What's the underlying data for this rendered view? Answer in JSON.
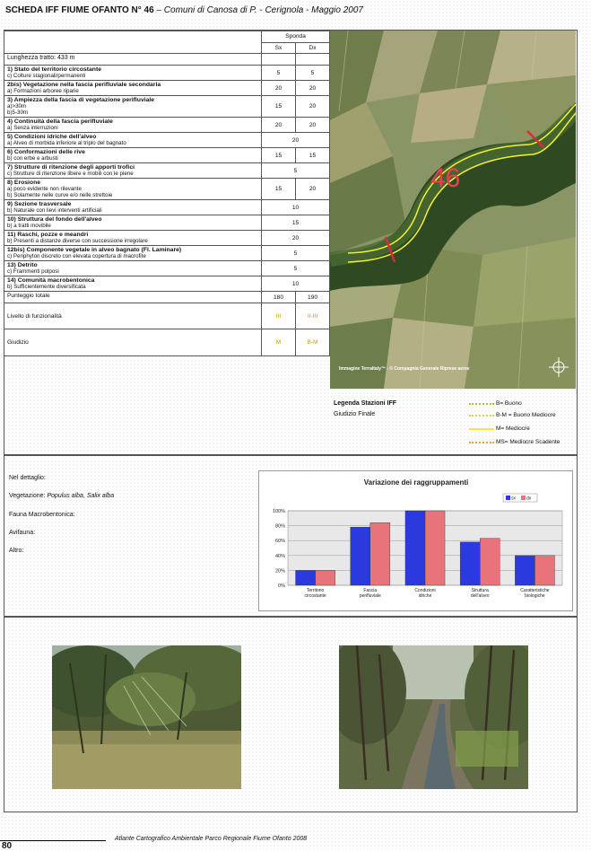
{
  "header": {
    "title_bold": "SCHEDA IFF FIUME OFANTO N° 46",
    "title_rest": " – Comuni di Canosa di P. - Cerignola - Maggio 2007"
  },
  "table": {
    "sponda_label": "Sponda",
    "sx_label": "Sx",
    "dx_label": "Dx",
    "lunghezza": "Lunghezza tratto: 433 m",
    "criteria": [
      {
        "title": "1) Stato del territorio circostante",
        "sub": "c) Colture stagionali/permanenti",
        "sx": "5",
        "dx": "5"
      },
      {
        "title": "2bis) Vegetazione nella fascia perifluviale secondaria",
        "sub": "a) Formazioni arboree riparie",
        "sx": "20",
        "dx": "20"
      },
      {
        "title": "3) Ampiezza della fascia di vegetazione perifluviale",
        "sub": "a)>30m",
        "sub2": "b)5-30m",
        "sx": "15",
        "dx": "20"
      },
      {
        "title": "4) Continuità della fascia perifluviale",
        "sub": "a) Senza interruzioni",
        "sx": "20",
        "dx": "20"
      },
      {
        "title": "5) Condizioni idriche dell'alveo",
        "sub": "a) Alveo di morbida inferiore al triplo del bagnato",
        "both": "20"
      },
      {
        "title": "6) Conformazioni delle rive",
        "sub": "b) con erbe e arbusti",
        "sx": "15",
        "dx": "15"
      },
      {
        "title": "7) Strutture di ritenzione degli apporti trofici",
        "sub": "c) Strutture di ritenzione libere e mobili con le piene",
        "both": "5"
      },
      {
        "title": "8) Erosione",
        "sub": "a) poco evidente  non rilevante",
        "sub2": "b) Solamente nelle curve e/o nelle strettoie",
        "sx": "15",
        "dx": "20"
      },
      {
        "title": "9) Sezione trasversale",
        "sub": "b) Naturale con lievi interventi artificiali",
        "both": "10"
      },
      {
        "title": "10) Struttura del fondo dell'alveo",
        "sub": "b) a tratti movibile",
        "both": "15"
      },
      {
        "title": "11) Raschi, pozze e meandri",
        "sub": "b) Presenti a distanze diverse con successione irregolare",
        "both": "20"
      },
      {
        "title": "12bis) Componente vegetale in alveo bagnato (Fl. Laminare)",
        "sub": "c) Periphyton discreto con elevata copertura di macrofite",
        "both": "5"
      },
      {
        "title": "13) Detrito",
        "sub": "c) Frammenti polposi",
        "both": "5"
      },
      {
        "title": "14) Comunità macrobentonica",
        "sub": "b) Sufficientemente diversificata",
        "both": "10"
      }
    ],
    "punteggio_label": "Punteggio totale",
    "punteggio_sx": "180",
    "punteggio_dx": "190",
    "livello_label": "Livello di funzionalità",
    "livello_sx": "III",
    "livello_dx": "II-III",
    "giudizio_label": "Giudizio",
    "giudizio_sx": "M",
    "giudizio_dx": "B-M"
  },
  "map": {
    "station_number": "46",
    "credit": "Immagine TerraItaly™ - © Compagnia Generale Riprese aeree"
  },
  "legend": {
    "title": "Legenda Stazioni IFF",
    "subtitle": "Giudizio Finale",
    "items": [
      {
        "label": "B= Buono",
        "color": "#9ccc33"
      },
      {
        "label": "B-M = Buono Mediocre",
        "color": "#c8dd44"
      },
      {
        "label": "M= Mediocre",
        "color": "#f2ea2a"
      },
      {
        "label": "MS= Mediocre Scadente",
        "color": "#e8a820"
      }
    ]
  },
  "details": {
    "dettaglio": "Nel dettaglio:",
    "vegetazione_label": "Vegetazione: ",
    "vegetazione_species1": "Populus alba",
    "vegetazione_sep": ", ",
    "vegetazione_species2": "Salix alba",
    "fauna": "Fauna Macrobentonica:",
    "avifauna": "Avifauna:",
    "altro": "Altro:"
  },
  "chart_data": {
    "type": "bar",
    "title": "Variazione dei raggruppamenti",
    "categories": [
      "Territorio circostante",
      "Fascia perifluviale",
      "Condizioni idriche",
      "Struttura dell'alveo",
      "Caratteristiche biologiche"
    ],
    "series": [
      {
        "name": "sx",
        "values": [
          20,
          78,
          100,
          58,
          40
        ],
        "color": "#2a3adf"
      },
      {
        "name": "dx",
        "values": [
          20,
          84,
          100,
          63,
          40
        ],
        "color": "#e8737a"
      }
    ],
    "yticks": [
      "0%",
      "20%",
      "40%",
      "60%",
      "80%",
      "100%"
    ],
    "ylim": [
      0,
      100
    ],
    "grid": true,
    "legend": "top-right"
  },
  "footer": {
    "page_number": "80",
    "text": "Atlante Cartografico Ambientale Parco Regionale Fiume Ofanto 2008"
  }
}
